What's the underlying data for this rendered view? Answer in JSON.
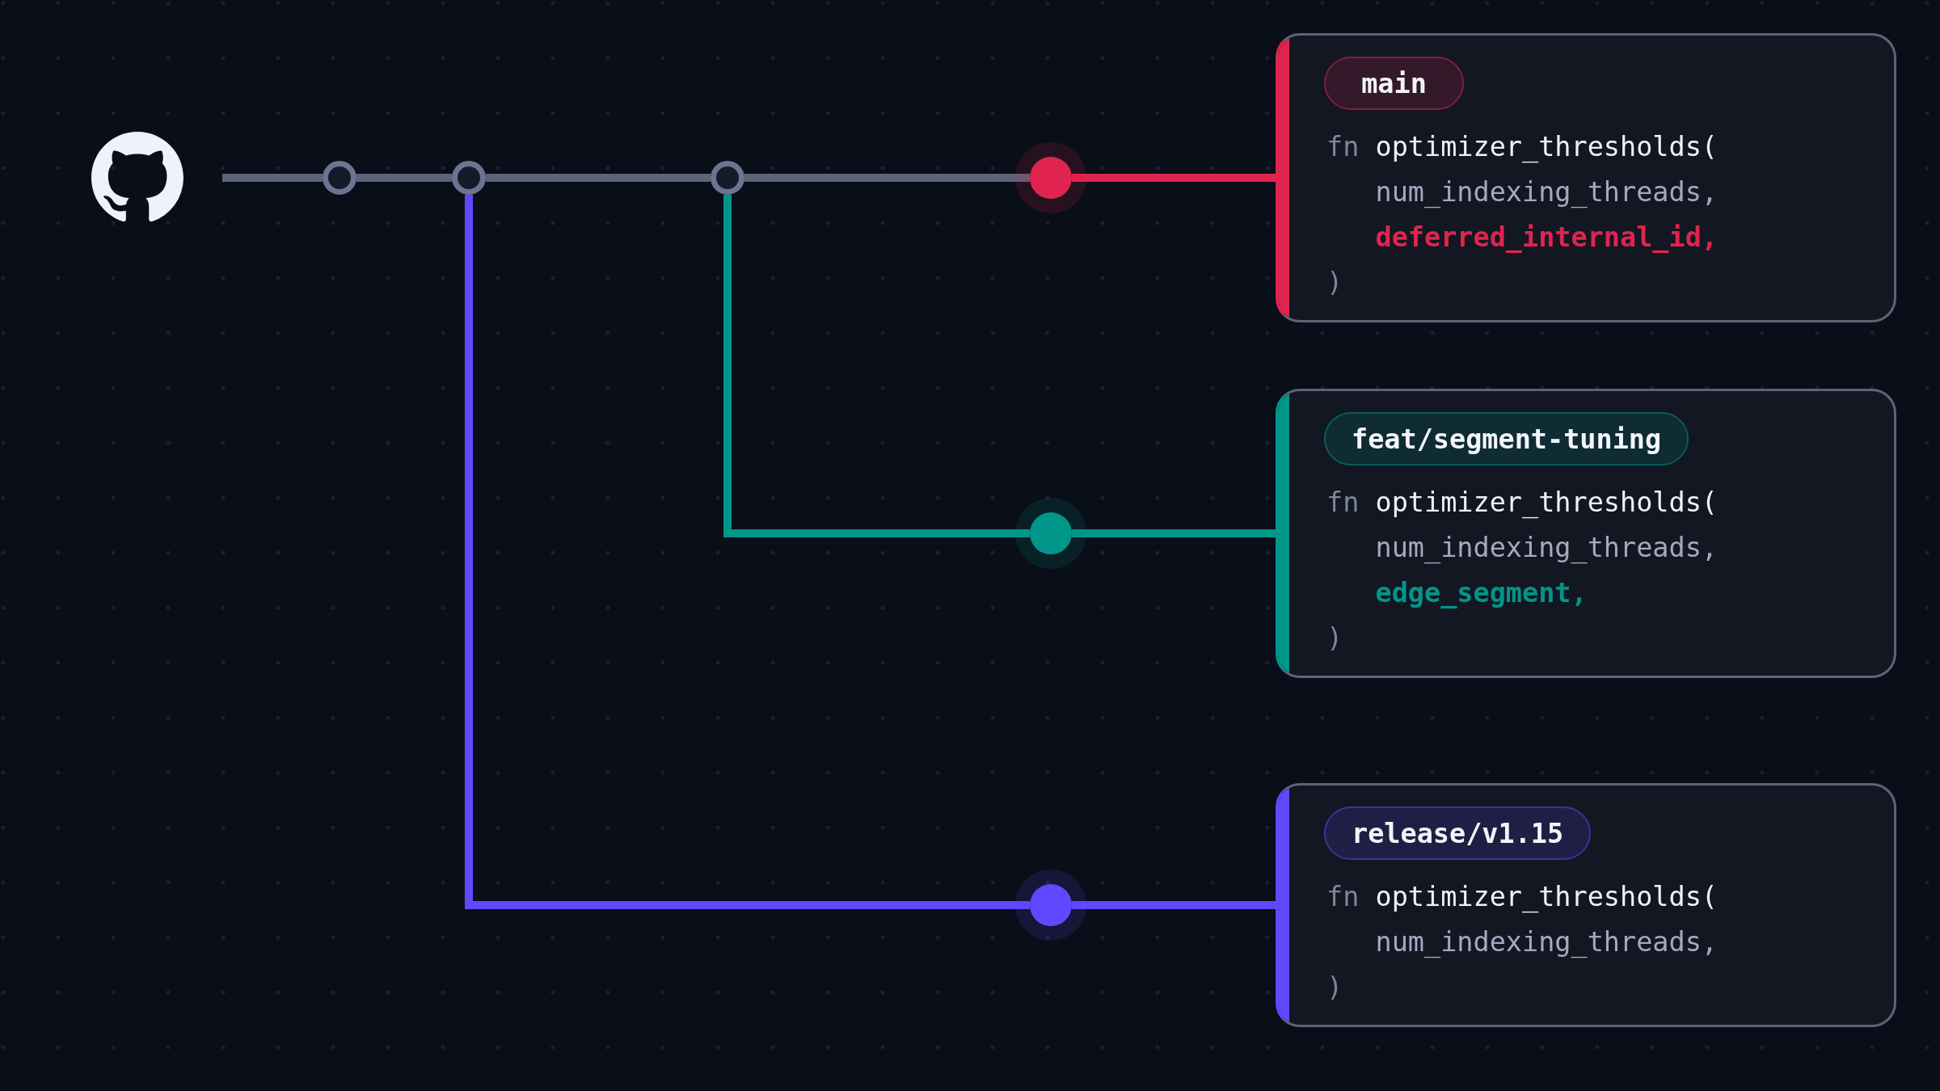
{
  "branches": [
    {
      "kind": "trunk",
      "name": "main",
      "color": "#e0244f",
      "signature": {
        "keyword": "fn",
        "function": "optimizer_thresholds(",
        "params": [
          {
            "text": "num_indexing_threads,",
            "highlighted": false
          },
          {
            "text": "deferred_internal_id,",
            "highlighted": true
          }
        ],
        "close": ")"
      }
    },
    {
      "kind": "fork",
      "name": "feat/segment-tuning",
      "color": "#00968a",
      "signature": {
        "keyword": "fn",
        "function": "optimizer_thresholds(",
        "params": [
          {
            "text": "num_indexing_threads,",
            "highlighted": false
          },
          {
            "text": "edge_segment,",
            "highlighted": true
          }
        ],
        "close": ")"
      }
    },
    {
      "kind": "fork",
      "name": "release/v1.15",
      "color": "#6148ff",
      "signature": {
        "keyword": "fn",
        "function": "optimizer_thresholds(",
        "params": [
          {
            "text": "num_indexing_threads,",
            "highlighted": false
          }
        ],
        "close": ")"
      }
    }
  ]
}
